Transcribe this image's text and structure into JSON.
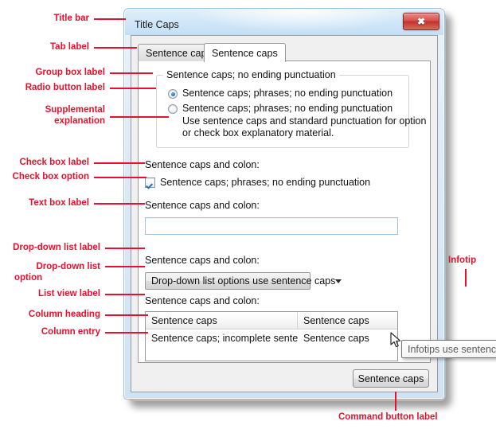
{
  "window": {
    "title": "Title Caps",
    "close_icon": "close-icon",
    "close_glyph": "✖"
  },
  "tabs": [
    {
      "label": "Sentence caps",
      "active": false
    },
    {
      "label": "Sentence caps",
      "active": true
    }
  ],
  "group_box": {
    "label": "Sentence caps; no ending punctuation",
    "radios": [
      {
        "label": "Sentence caps; phrases;  no ending punctuation",
        "checked": true
      },
      {
        "label": "Sentence caps; phrases;  no ending punctuation",
        "checked": false
      }
    ],
    "supplemental_line1": "Use sentence caps and standard punctuation for option",
    "supplemental_line2": "or check box explanatory material."
  },
  "checkbox_section": {
    "label": "Sentence caps and colon:",
    "option_label": "Sentence caps; phrases;  no ending punctuation",
    "checked": true
  },
  "textbox_section": {
    "label": "Sentence caps and colon:",
    "value": "",
    "placeholder": ""
  },
  "dropdown_section": {
    "label": "Sentence caps and colon:",
    "selected": "Drop-down list options use sentence caps",
    "arrow_icon": "chevron-down-icon"
  },
  "infotip": {
    "text": "Infotips use sentence caps and ending punctuation."
  },
  "listview_section": {
    "label": "Sentence caps and colon:",
    "columns": [
      "Sentence caps",
      "Sentence caps"
    ],
    "rows": [
      [
        "Sentence caps; incomplete sentences",
        "Sentence caps"
      ]
    ]
  },
  "command_button": {
    "label": "Sentence caps"
  },
  "annotations": {
    "title_bar": "Title bar",
    "tab_label": "Tab label",
    "group_box_label": "Group box label",
    "radio_button_label": "Radio button label",
    "supplemental_explanation_line1": "Supplemental",
    "supplemental_explanation_line2": "explanation",
    "check_box_label": "Check box label",
    "check_box_option": "Check box option",
    "text_box_label": "Text box label",
    "drop_down_list_label": "Drop-down list label",
    "drop_down_list_option_line1": "Drop-down list",
    "drop_down_list_option_line2": "option",
    "list_view_label": "List view label",
    "column_heading": "Column heading",
    "column_entry": "Column entry",
    "infotip": "Infotip",
    "command_button_label": "Command button label"
  },
  "colors": {
    "annotation_red": "#e8112d",
    "window_border_blue": "#9cc4e0",
    "close_button_red": "#c0342c",
    "accent_blue": "#1f72b5"
  }
}
